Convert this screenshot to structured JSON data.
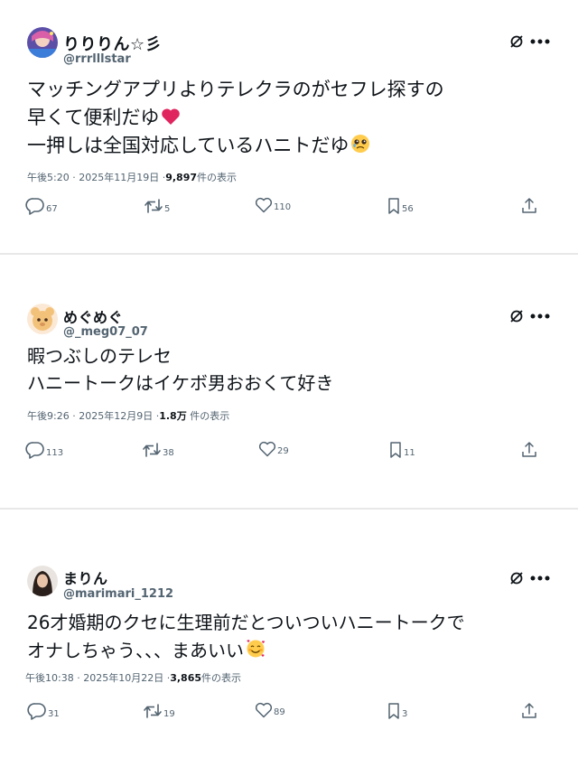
{
  "posts": [
    {
      "display_name": "りりりん☆彡",
      "handle": "@rrrlllstar",
      "text_lines": [
        "マッチングアプリよりテレクラのがセフレ探すの",
        "早くて便利だゆ",
        "一押しは全国対応しているハニトだゆ"
      ],
      "emoji_line2": "red-heart",
      "emoji_line3": "pleading-face",
      "meta_time": "午後5:20",
      "meta_date": "2025年11月19日",
      "meta_views": "9,897",
      "meta_views_suffix": "件の表示",
      "replies": "67",
      "reposts": "5",
      "likes": "110",
      "bookmarks": "56"
    },
    {
      "display_name": "めぐめぐ",
      "handle": "@_meg07_07",
      "text_lines": [
        "暇つぶしのテレセ",
        "ハニートークはイケボ男おおくて好き"
      ],
      "meta_time": "午後9:26",
      "meta_date": "2025年12月9日",
      "meta_views": "1.8万",
      "meta_views_suffix": "件の表示",
      "replies": "113",
      "reposts": "38",
      "likes": "29",
      "bookmarks": "11"
    },
    {
      "display_name": "まりん",
      "handle": "@marimari_1212",
      "text_lines": [
        "26才婚期のクセに生理前だとついついハニートークで",
        "オナしちゃう、、、まあいい"
      ],
      "emoji_line2": "smiling-face-with-hearts",
      "meta_time": "午後10:38",
      "meta_date": "2025年10月22日",
      "meta_views": "3,865",
      "meta_views_suffix": "件の表示",
      "replies": "31",
      "reposts": "19",
      "likes": "89",
      "bookmarks": "3"
    }
  ],
  "separator": "·",
  "colors": {
    "text": "#0f1419",
    "secondary": "#536471",
    "divider": "#e8e8e8",
    "heart": "#e0245e"
  },
  "icons": [
    "grok-icon",
    "more-icon",
    "reply-icon",
    "repost-icon",
    "like-icon",
    "bookmark-icon",
    "share-icon"
  ]
}
